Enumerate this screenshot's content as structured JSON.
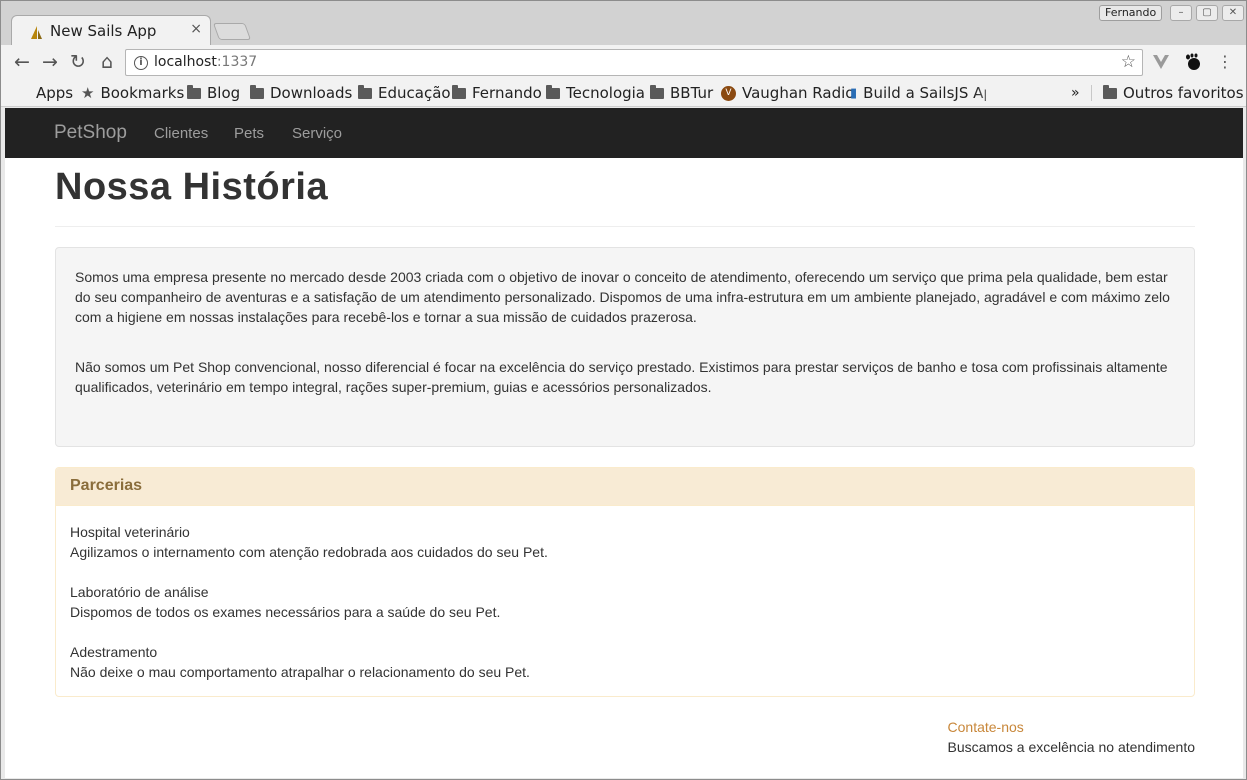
{
  "browser": {
    "tab_title": "New Sails App",
    "tab_close": "×",
    "profile": "Fernando",
    "url_host": "localhost",
    "url_port": ":1337",
    "bookmarks": [
      {
        "label": "Apps",
        "icon": "apps-grid-icon"
      },
      {
        "label": "Bookmarks",
        "icon": "star-icon"
      },
      {
        "label": "Blog",
        "icon": "folder-icon"
      },
      {
        "label": "Downloads",
        "icon": "folder-icon"
      },
      {
        "label": "Educação",
        "icon": "folder-icon"
      },
      {
        "label": "Fernando",
        "icon": "folder-icon"
      },
      {
        "label": "Tecnologia",
        "icon": "folder-icon"
      },
      {
        "label": "BBTur",
        "icon": "folder-icon"
      },
      {
        "label": "Vaughan Radio",
        "icon": "vaughan-icon"
      },
      {
        "label": "Build a SailsJS App",
        "icon": "page-icon"
      },
      {
        "label": "Outros favoritos",
        "icon": "folder-icon"
      }
    ],
    "overflow": "»"
  },
  "navbar": {
    "brand": "PetShop",
    "links": [
      "Clientes",
      "Pets",
      "Serviço"
    ]
  },
  "page": {
    "title": "Nossa História",
    "paragraphs": [
      "Somos uma empresa presente no mercado desde 2003 criada com o objetivo de inovar o conceito de atendimento, oferecendo um serviço que prima pela qualidade, bem estar do seu companheiro de aventuras e a satisfação de um atendimento personalizado. Dispomos de uma infra-estrutura em um ambiente planejado, agradável e com máximo zelo com a higiene em nossas instalações para recebê-los e tornar a sua missão de cuidados prazerosa.",
      "Não somos um Pet Shop convencional, nosso diferencial é focar na excelência do serviço prestado. Existimos para prestar serviços de banho e tosa com profissinais altamente qualificados, veterinário em tempo integral, rações super-premium, guias e acessórios personalizados."
    ],
    "panel": {
      "title": "Parcerias",
      "partners": [
        {
          "name": "Hospital veterinário",
          "desc": "Agilizamos o internamento com atenção redobrada aos cuidados do seu Pet."
        },
        {
          "name": "Laboratório de análise",
          "desc": "Dispomos de todos os exames necessários para a saúde do seu Pet."
        },
        {
          "name": "Adestramento",
          "desc": "Não deixe o mau comportamento atrapalhar o relacionamento do seu Pet."
        }
      ]
    },
    "footer": {
      "contact": "Contate-nos",
      "tagline": "Buscamos a excelência no atendimento"
    }
  },
  "colors": {
    "navbar_bg": "#222222",
    "panel_heading": "#8a6d3b",
    "contact_link": "#c8873a"
  }
}
